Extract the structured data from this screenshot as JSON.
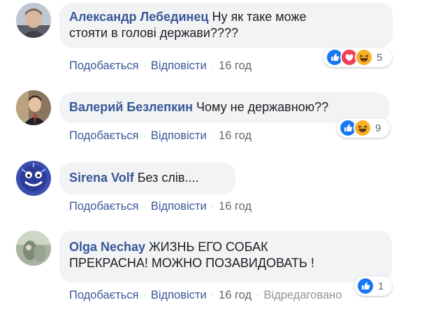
{
  "comments": [
    {
      "author": "Александр Лебединец",
      "text_line1": "Ну як таке може",
      "text_line2": "стояти в голові держави????",
      "like_label": "Подобається",
      "reply_label": "Відповісти",
      "time": "16 год",
      "reactions": [
        "like-icon",
        "love-icon",
        "haha-icon"
      ],
      "reaction_count": "5"
    },
    {
      "author": "Валерий Безлепкин",
      "text_line1": "Чому не державною??",
      "like_label": "Подобається",
      "reply_label": "Відповісти",
      "time": "16 год",
      "reactions": [
        "like-icon",
        "haha-icon"
      ],
      "reaction_count": "9"
    },
    {
      "author": "Sirena Volf",
      "text_line1": "Без слів....",
      "like_label": "Подобається",
      "reply_label": "Відповісти",
      "time": "16 год"
    },
    {
      "author": "Olga Nechay",
      "text_line1": "ЖИЗНЬ ЕГО СОБАК",
      "text_line2": "ПРЕКРАСНА! МОЖНО ПОЗАВИДОВАТЬ !",
      "like_label": "Подобається",
      "reply_label": "Відповісти",
      "time": "16 год",
      "edited_label": "Відредаговано",
      "reactions": [
        "like-icon"
      ],
      "reaction_count": "1"
    }
  ],
  "colors": {
    "link": "#385898",
    "bubble": "#f2f3f5",
    "like_blue": "#1877f2",
    "love_red": "#f33e58",
    "haha_yellow": "#f7b125"
  }
}
